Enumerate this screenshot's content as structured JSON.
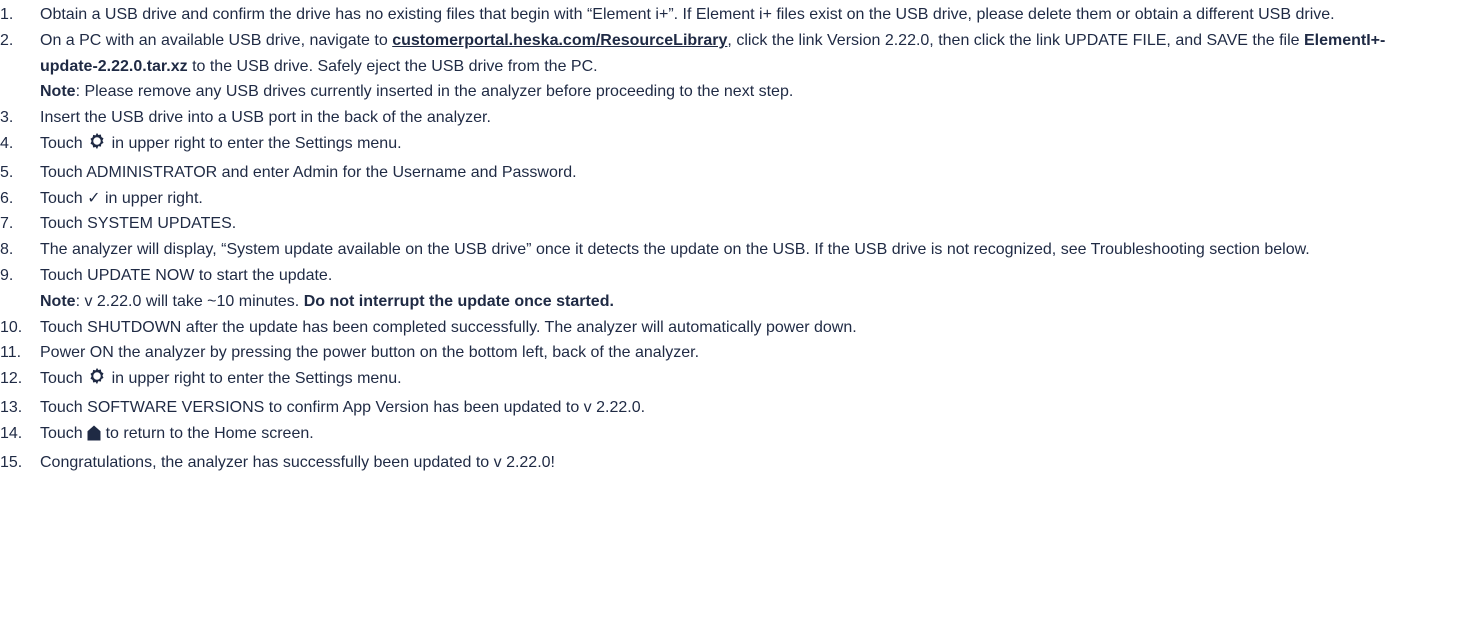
{
  "colors": {
    "text": "#1f2a44",
    "background": "#ffffff"
  },
  "steps": [
    {
      "num": "1.",
      "text_a": "Obtain a USB drive and confirm the drive has no existing files that begin with “Element i+”. If Element i+ files exist on the USB drive, please delete them or obtain a different USB drive."
    },
    {
      "num": "2.",
      "text_a": "On a PC with an available USB drive, navigate to ",
      "link": "customerportal.heska.com/ResourceLibrary",
      "text_b": ", click the link Version 2.22.0, then click the link UPDATE FILE, and SAVE the file ",
      "file": "ElementI+-update-2.22.0.tar.xz",
      "text_c": " to the USB drive. Safely eject the USB drive from the PC.",
      "note_label": "Note",
      "note_text": ": Please remove any USB drives currently inserted in the analyzer before proceeding to the next step."
    },
    {
      "num": "3.",
      "text_a": "Insert the USB drive into a USB port in the back of the analyzer."
    },
    {
      "num": "4.",
      "text_a": "Touch ",
      "icon": "gear-icon",
      "text_b": " in upper right to enter the Settings menu."
    },
    {
      "num": "5.",
      "text_a": "Touch ADMINISTRATOR and enter Admin for the Username and Password."
    },
    {
      "num": "6.",
      "text_a": "Touch ",
      "icon_glyph": "✓",
      "text_b": " in upper right."
    },
    {
      "num": "7.",
      "text_a": "Touch SYSTEM UPDATES."
    },
    {
      "num": "8.",
      "text_a": "The analyzer will display, “System update available on the USB drive” once it detects the update on the USB. If the USB drive is not recognized, see Troubleshooting section below."
    },
    {
      "num": "9.",
      "text_a": "Touch UPDATE NOW to start the update.",
      "note_label": "Note",
      "note_text": ": v 2.22.0 will take ~10 minutes. ",
      "note_bold": "Do not interrupt the update once started."
    },
    {
      "num": "10.",
      "text_a": "Touch SHUTDOWN after the update has been completed successfully. The analyzer will automatically power down."
    },
    {
      "num": "11.",
      "text_a": "Power ON the analyzer by pressing the power button on the bottom left, back of the analyzer."
    },
    {
      "num": "12.",
      "text_a": "Touch ",
      "icon": "gear-icon",
      "text_b": " in upper right to enter the Settings menu."
    },
    {
      "num": "13.",
      "text_a": "Touch SOFTWARE VERSIONS to confirm App Version has been updated to v 2.22.0."
    },
    {
      "num": "14.",
      "text_a": "Touch ",
      "icon": "home-icon",
      "text_b": " to return to the Home screen."
    },
    {
      "num": "15.",
      "text_a": "Congratulations, the analyzer has successfully been updated to v 2.22.0!"
    }
  ]
}
